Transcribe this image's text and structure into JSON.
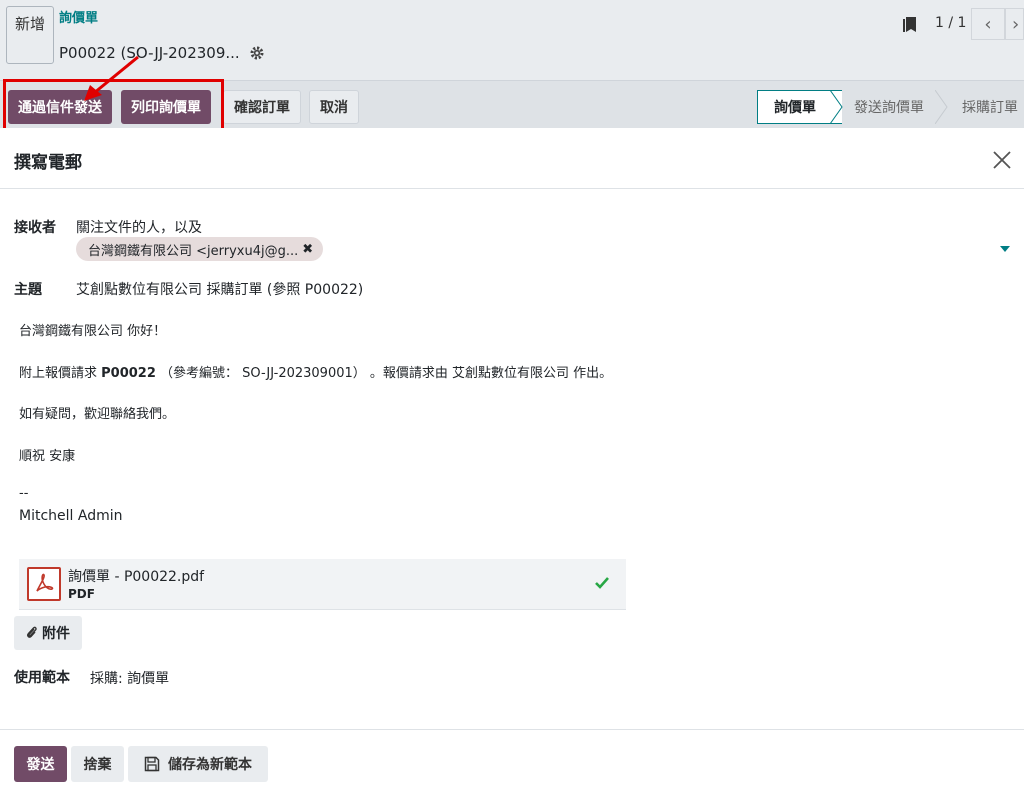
{
  "background": {
    "new_button": "新增",
    "breadcrumb": "詢價單",
    "record_title": "P00022 (SO-JJ-202309...",
    "pager": "1 / 1",
    "pager_prev": "‹",
    "pager_next": "›",
    "toolbar": {
      "send_by_email": "通過信件發送",
      "print_rfq": "列印詢價單",
      "confirm_order": "確認訂單",
      "cancel": "取消"
    },
    "stages": [
      "詢價單",
      "發送詢價單",
      "採購訂單"
    ]
  },
  "modal": {
    "title": "撰寫電郵",
    "recipients_label": "接收者",
    "recipients_hint": "關注文件的人，以及",
    "recipient_tag": "台灣鋼鐵有限公司 <jerryxu4j@g...",
    "recipient_tag_remove": "✖",
    "subject_label": "主題",
    "subject_value": "艾創點數位有限公司 採購訂單 (參照 P00022)",
    "body": {
      "greeting": "台灣鋼鐵有限公司 你好！",
      "line2_prefix": "附上報價請求 ",
      "line2_ref": "P00022",
      "line2_suffix": " （參考編號： SO-JJ-202309001） 。報價請求由 艾創點數位有限公司 作出。",
      "line3": "如有疑問，歡迎聯絡我們。",
      "line4": "順祝 安康",
      "signature_sep": "--",
      "signature_name": "Mitchell Admin"
    },
    "attachment": {
      "name": "詢價單 - P00022.pdf",
      "type": "PDF"
    },
    "attach_button": "附件",
    "template_label": "使用範本",
    "template_value": "採購: 詢價單",
    "footer": {
      "send": "發送",
      "discard": "捨棄",
      "save_template": "儲存為新範本"
    }
  },
  "colors": {
    "primary": "#714b67",
    "teal": "#017e84",
    "highlight_red": "#e00000",
    "success": "#28a745"
  }
}
